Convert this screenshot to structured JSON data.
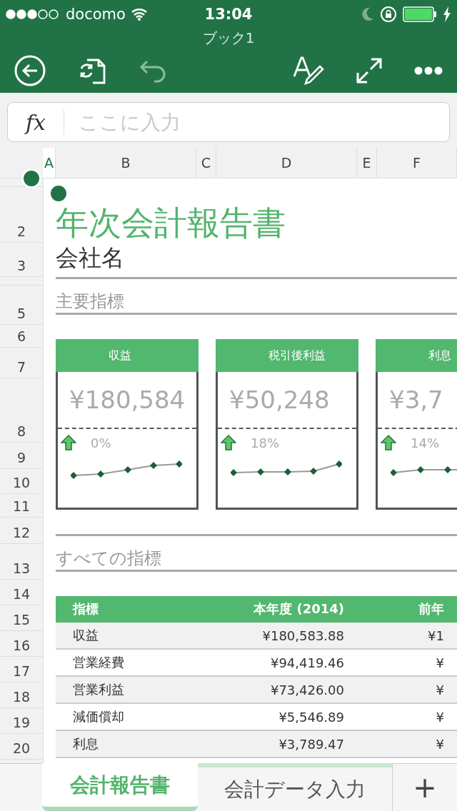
{
  "status_bar": {
    "carrier": "docomo",
    "time": "13:04"
  },
  "window": {
    "title": "ブック1"
  },
  "formula_bar": {
    "label": "fx",
    "placeholder": "ここに入力"
  },
  "columns": [
    {
      "label": "A",
      "selected": true
    },
    {
      "label": "B",
      "selected": false
    },
    {
      "label": "C",
      "selected": false
    },
    {
      "label": "D",
      "selected": false
    },
    {
      "label": "E",
      "selected": false
    },
    {
      "label": "F",
      "selected": false
    }
  ],
  "rows": [
    "2",
    "3",
    "5",
    "6",
    "7",
    "8",
    "9",
    "10",
    "11",
    "12",
    "13",
    "14",
    "15",
    "16",
    "17",
    "18",
    "19",
    "20"
  ],
  "sheet": {
    "title": "年次会計報告書",
    "company": "会社名",
    "section_1": "主要指標",
    "section_2": "すべての指標"
  },
  "cards": [
    {
      "title": "収益",
      "value": "¥180,584",
      "change": "0%"
    },
    {
      "title": "税引後利益",
      "value": "¥50,248",
      "change": "18%"
    },
    {
      "title": "利息",
      "value": "¥3,7",
      "change": "14%"
    }
  ],
  "table": {
    "columns": [
      "指標",
      "本年度 (2014)",
      "前年"
    ],
    "rows": [
      [
        "収益",
        "¥180,583.88",
        "¥1"
      ],
      [
        "営業経費",
        "¥94,419.46",
        "¥"
      ],
      [
        "営業利益",
        "¥73,426.00",
        "¥"
      ],
      [
        "減価償却",
        "¥5,546.89",
        "¥"
      ],
      [
        "利息",
        "¥3,789.47",
        "¥"
      ]
    ]
  },
  "sheet_tabs": [
    {
      "label": "会計報告書",
      "selected": true
    },
    {
      "label": "会計データ入力",
      "selected": false
    }
  ],
  "add_sheet": "+"
}
